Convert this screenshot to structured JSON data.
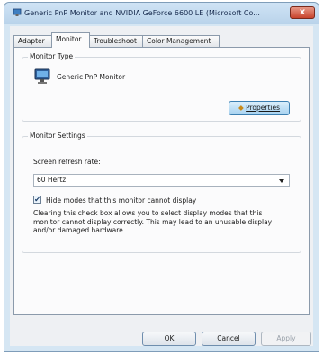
{
  "window": {
    "title": "Generic PnP Monitor and NVIDIA GeForce 6600 LE (Microsoft Co...",
    "close_label": "x"
  },
  "tabs": [
    {
      "label": "Adapter",
      "active": false
    },
    {
      "label": "Monitor",
      "active": true
    },
    {
      "label": "Troubleshoot",
      "active": false
    },
    {
      "label": "Color Management",
      "active": false
    }
  ],
  "monitor_type": {
    "group_title": "Monitor Type",
    "monitor_name": "Generic PnP Monitor",
    "properties_button": "Properties",
    "icon": "monitor-icon"
  },
  "monitor_settings": {
    "group_title": "Monitor Settings",
    "refresh_label": "Screen refresh rate:",
    "refresh_value": "60 Hertz",
    "hide_modes_label": "Hide modes that this monitor cannot display",
    "hide_modes_checked": true,
    "description": "Clearing this check box allows you to select display modes that this monitor cannot display correctly. This may lead to an unusable display and/or damaged hardware."
  },
  "footer": {
    "ok": "OK",
    "cancel": "Cancel",
    "apply": "Apply"
  }
}
